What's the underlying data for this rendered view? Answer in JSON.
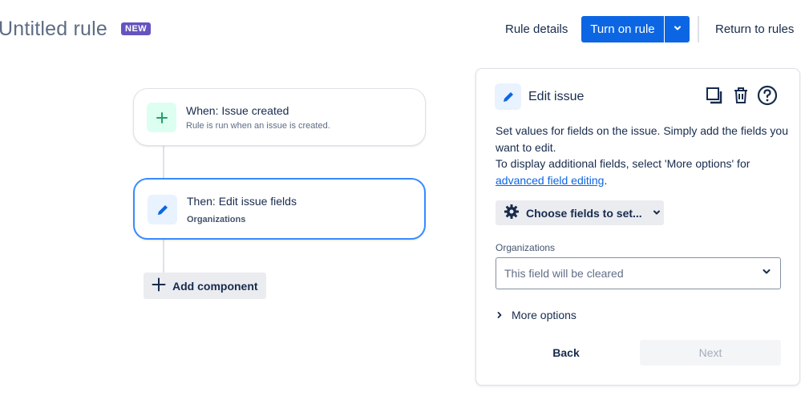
{
  "header": {
    "title": "Untitled rule",
    "badge": "NEW",
    "rule_details_label": "Rule details",
    "turn_on_label": "Turn on rule",
    "return_label": "Return to rules"
  },
  "flow": {
    "trigger": {
      "title": "When: Issue created",
      "subtitle": "Rule is run when an issue is created.",
      "icon": "plus-icon"
    },
    "action": {
      "title": "Then: Edit issue fields",
      "subtitle": "Organizations",
      "icon": "pencil-icon"
    },
    "add_component_label": "Add component"
  },
  "panel": {
    "title": "Edit issue",
    "icon": "pencil-icon",
    "tools": [
      "duplicate-icon",
      "trash-icon",
      "help-icon"
    ],
    "description_line1": "Set values for fields on the issue. Simply add the fields you want to edit.",
    "description_line2": "To display additional fields, select 'More options' for",
    "description_link": "advanced field editing",
    "description_end": ".",
    "choose_fields_label": "Choose fields to set...",
    "field_label": "Organizations",
    "field_placeholder": "This field will be cleared",
    "more_options_label": "More options",
    "back_label": "Back",
    "next_label": "Next"
  },
  "colors": {
    "primary": "#0c66e4",
    "badge": "#6554c0",
    "trigger_icon_bg": "#dcfff1",
    "trigger_icon": "#22a06b",
    "action_icon_bg": "#e9f2ff",
    "action_icon": "#0c66e4",
    "selected_border": "#388bff"
  }
}
